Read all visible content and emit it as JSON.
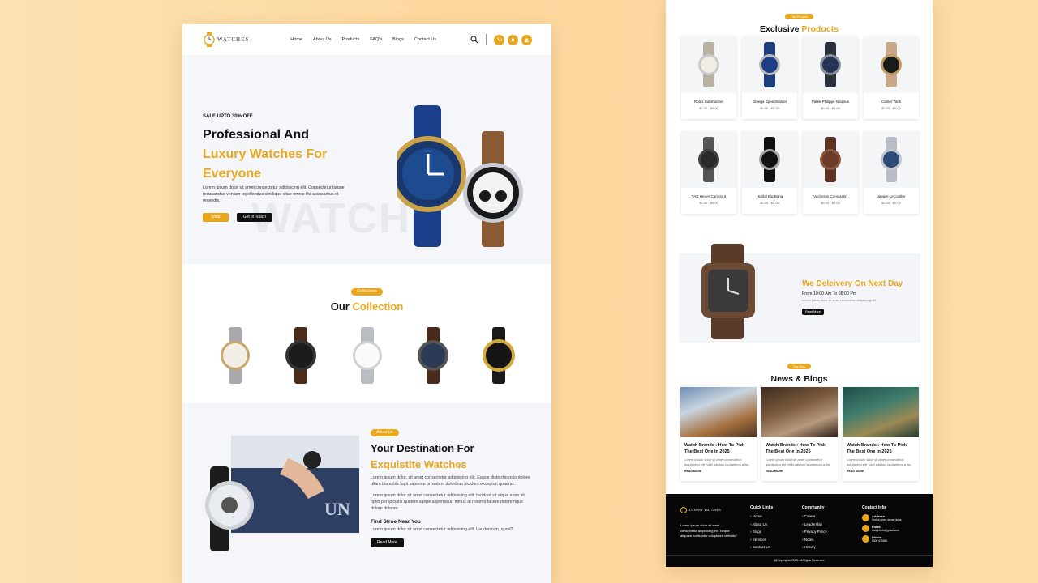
{
  "left": {
    "logo": {
      "text": "WATCHES"
    },
    "nav": [
      "Home",
      "About Us",
      "Products",
      "FAQ's",
      "Blogs",
      "Contact Us"
    ],
    "hero": {
      "kicker": "SALE UPTO 30% OFF",
      "title_line1": "Professional And",
      "title_line2": "Luxury Watches For",
      "title_line3": "Everyone",
      "paragraph": "Lorem ipsum dolor sit amet consectetur adipisicing elit. Consectetur itaque recusandae veniam repellendus similique vitae omnis illo accusamus et recendis.",
      "shop_button": "Shop",
      "contact_button": "Get In Touch",
      "watermark": "WATCH"
    },
    "collection": {
      "badge": "Collections",
      "title_plain": "Our",
      "title_gold": "Collection"
    },
    "about": {
      "badge": "About Us",
      "title_line1": "Your Destination For",
      "title_line2": "Exquistite Watches",
      "para1": "Lorem ipsum dolor, sit amet consectetur adipisicing elit. Eaque distinctio odio dolore ullam blanditiis fugit sapiente provident doloribus incidunt excepturi quaerat.",
      "para2": "Lorem ipsum dolor sit amet consectetur adipisicing elit. Incidunt sit atque enim sit optio perspiciatis quidem saepe aspernatur, minus at minima facere doloremque dolore dolores.",
      "find_title": "Find Stroe Near You",
      "find_text": "Lorem ipsum dolor sit amet consectetur adipisicing elit. Laudantium, quod?",
      "read_more": "Read More"
    }
  },
  "right": {
    "products": {
      "badge": "Our Product",
      "title_plain": "Exclusive",
      "title_gold": "Products",
      "items": [
        {
          "name": "Rolex Submariner",
          "price": "$0.00 - $0.00"
        },
        {
          "name": "Omega Speedmaster",
          "price": "$0.00 - $0.00"
        },
        {
          "name": "Patek Philippe Nautilus",
          "price": "$0.00 - $0.00"
        },
        {
          "name": "Cartier Tank",
          "price": "$0.00 - $0.00"
        },
        {
          "name": "TAG Heuer Carrera II",
          "price": "$0.00 - $0.00"
        },
        {
          "name": "Hublot Big Bang",
          "price": "$0.00 - $0.00"
        },
        {
          "name": "Vacheron Constantin",
          "price": "$0.00 - $0.00"
        },
        {
          "name": "Jaeger-LeCoultre",
          "price": "$0.00 - $0.00"
        }
      ]
    },
    "delivery": {
      "title": "We Deleivery On Next Day",
      "hours": "From 10:00 Am To 08:00 Pm",
      "text": "Lorem ipsum dolor sit amet consectetur adipisicing elit.",
      "button": "Read More"
    },
    "blogs": {
      "badge": "Our Blog",
      "title": "News & Blogs",
      "items": [
        {
          "title": "Watch Brands : How To Pick The Best One In 2025",
          "text": "Lorem ipsum dolor sit amet consectetur adipisicing elit. Velit adipisci laudantium a illo.",
          "more": "READ MORE"
        },
        {
          "title": "Watch Brands : How To Pick The Best One In 2025",
          "text": "Lorem ipsum dolor sit amet consectetur adipisicing elit. Velit adipisci laudantium a illo.",
          "more": "READ MORE"
        },
        {
          "title": "Watch Brands : How To Pick The Best One In 2025",
          "text": "Lorem ipsum dolor sit amet consectetur adipisicing elit. Velit adipisci laudantium a illo.",
          "more": "READ MORE"
        }
      ]
    },
    "footer": {
      "logo": "LUXURY WATCHES",
      "about": "Lorem ipsum dolor sit amet consectetur adipisicing elit. Neque aliquam nobis odio voluptates veritatis?",
      "quick_title": "Quick Links",
      "quick": [
        "Home",
        "About Us",
        "Blogs",
        "Services",
        "Contact Us"
      ],
      "community_title": "Community",
      "community": [
        "Career",
        "Leadership",
        "Privacy Policy",
        "Notes",
        "History"
      ],
      "contact_title": "Contact Info",
      "contact": [
        {
          "label": "Address",
          "value": "Sed ut amet, ipsum dolor."
        },
        {
          "label": "Email",
          "value": "luxlightinfo@gmail.com"
        },
        {
          "label": "Phone",
          "value": "0300 470560"
        }
      ],
      "copyright": "@Copyrights 2025. All Rights Reserved"
    }
  }
}
